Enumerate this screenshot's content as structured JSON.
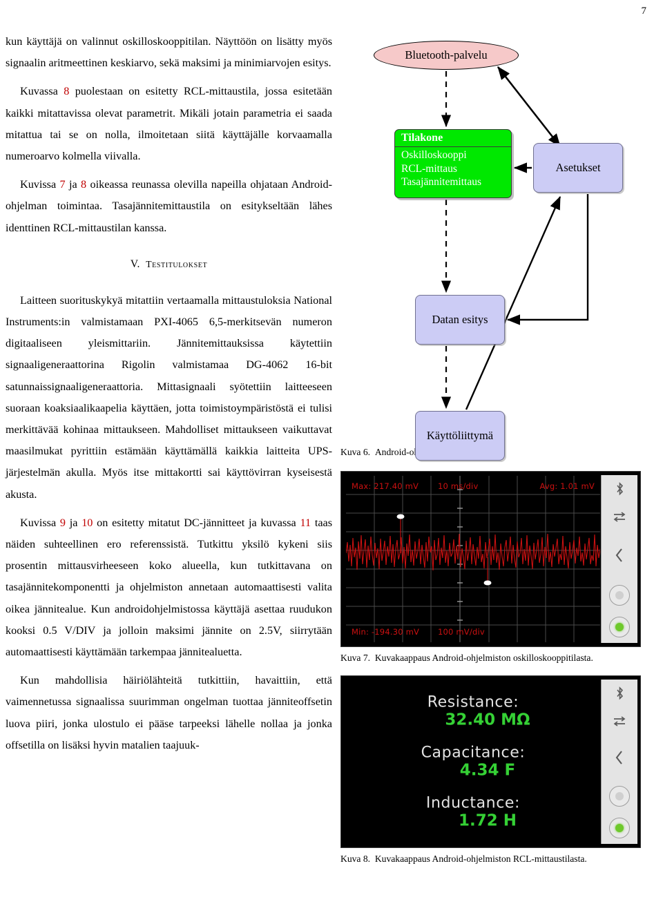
{
  "page": {
    "number": "7"
  },
  "left_column": {
    "paragraphs": [
      {
        "id": "p1",
        "indent": false,
        "text": "kun käyttäjä on valinnut oskilloskooppitilan. Näyttöön on lisätty myös signaalin aritmeettinen keskiarvo, sekä maksimi ja minimiarvojen esitys."
      },
      {
        "id": "p2",
        "indent": true,
        "text_before": "Kuvassa ",
        "ref1": "8",
        "text_after": " puolestaan on esitetty RCL-mittaustila, jossa esitetään kaikki mitattavissa olevat parametrit. Mikäli jotain parametria ei saada mitattua tai se on nolla, ilmoitetaan siitä käyttäjälle korvaamalla numeroarvo kolmella viivalla."
      },
      {
        "id": "p3",
        "indent": true,
        "text_before": "Kuvissa ",
        "ref1": "7",
        "text_mid": " ja ",
        "ref2": "8",
        "text_after": " oikeassa reunassa olevilla napeilla ohjataan Android-ohjelman toimintaa. Tasajännitemittaustila on esitykseltään lähes identtinen RCL-mittaustilan kanssa."
      }
    ],
    "section_heading": {
      "numeral": "V.",
      "title": "Testitulokset"
    },
    "paragraphs2": [
      {
        "id": "p4",
        "indent": true,
        "text": "Laitteen suorituskykyä mitattiin vertaamalla mittaustuloksia National Instruments:in valmistamaan PXI-4065 6,5-merkitsevän numeron digitaaliseen yleismittariin. Jännitemittauksissa käytettiin signaaligeneraattorina Rigolin valmistamaa DG-4062 16-bit satunnaissignaaligeneraattoria. Mittasignaali syötettiin laitteeseen suoraan koaksiaalikaapelia käyttäen, jotta toimistoympäristöstä ei tulisi merkittävää kohinaa mittaukseen. Mahdolliset mittaukseen vaikuttavat maasilmukat pyrittiin estämään käyttämällä kaikkia laitteita UPS-järjestelmän akulla. Myös itse mittakortti sai käyttövirran kyseisestä akusta."
      },
      {
        "id": "p5",
        "indent": true,
        "text_before": "Kuvissa ",
        "ref1": "9",
        "text_mid": " ja ",
        "ref2": "10",
        "text_mid2": " on esitetty mitatut DC-jännitteet ja kuvassa ",
        "ref3": "11",
        "text_after": " taas näiden suhteellinen ero referenssistä. Tutkittu yksilö kykeni siis prosentin mittausvirheeseen koko alueella, kun tutkittavana on tasajännitekomponentti ja ohjelmiston annetaan automaattisesti valita oikea jännitealue. Kun androidohjelmistossa käyttäjä asettaa ruudukon kooksi 0.5 V/DIV ja jolloin maksimi jännite on 2.5V, siirrytään automaattisesti käyttämään tarkempaa jännitealuetta."
      },
      {
        "id": "p6",
        "indent": true,
        "text": "Kun mahdollisia häiriölähteitä tutkittiin, havaittiin, että vaimennetussa signaalissa suurimman ongelman tuottaa jänniteoffsetin luova piiri, jonka ulostulo ei pääse tarpeeksi lähelle nollaa ja jonka offsetilla on lisäksi hyvin matalien taajuuk-"
      }
    ]
  },
  "diagram": {
    "nodes": {
      "bluetooth": {
        "label": "Bluetooth-palvelu",
        "fill": "#f6c9c9",
        "shape": "ellipse"
      },
      "state_machine": {
        "title": "Tilakone",
        "items": [
          "Oskilloskooppi",
          "RCL-mittaus",
          "Tasajännitemittaus"
        ],
        "fill": "#00e800",
        "text_color": "#ffffff"
      },
      "settings": {
        "label": "Asetukset",
        "fill": "#ccccf5"
      },
      "data_display": {
        "label": "Datan esitys",
        "fill": "#ccccf5"
      },
      "ui": {
        "label": "Käyttöliittymä",
        "fill": "#ccccf5"
      }
    },
    "caption": {
      "label": "Kuva 6.",
      "text": "Android-ohjelmiston vuokaavio."
    }
  },
  "figure7": {
    "caption": {
      "label": "Kuva 7.",
      "text": "Kuvakaappaus Android-ohjelmiston oskilloskooppitilasta."
    },
    "screen": {
      "max": "Max: 217.40 mV",
      "timebase": "10 ms/div",
      "avg": "Avg: 1.01 mV",
      "min": "Min: -194.30 mV",
      "voltdiv": "100 mV/div",
      "trace_color": "#cc1111",
      "bg_color": "#000000"
    },
    "buttons": [
      "bluetooth-icon",
      "loop-icon",
      "back-icon",
      "knob-off",
      "knob-on"
    ]
  },
  "figure8": {
    "caption": {
      "label": "Kuva 8.",
      "text": "Kuvakaappaus Android-ohjelmiston RCL-mittaustilasta."
    },
    "readouts": [
      {
        "name": "Resistance:",
        "value": "32.40 MΩ"
      },
      {
        "name": "Capacitance:",
        "value": "4.34 F"
      },
      {
        "name": "Inductance:",
        "value": "1.72 H"
      }
    ],
    "value_color": "#35d135",
    "buttons": [
      "bluetooth-icon",
      "loop-icon",
      "back-icon",
      "knob-off",
      "knob-on"
    ]
  }
}
